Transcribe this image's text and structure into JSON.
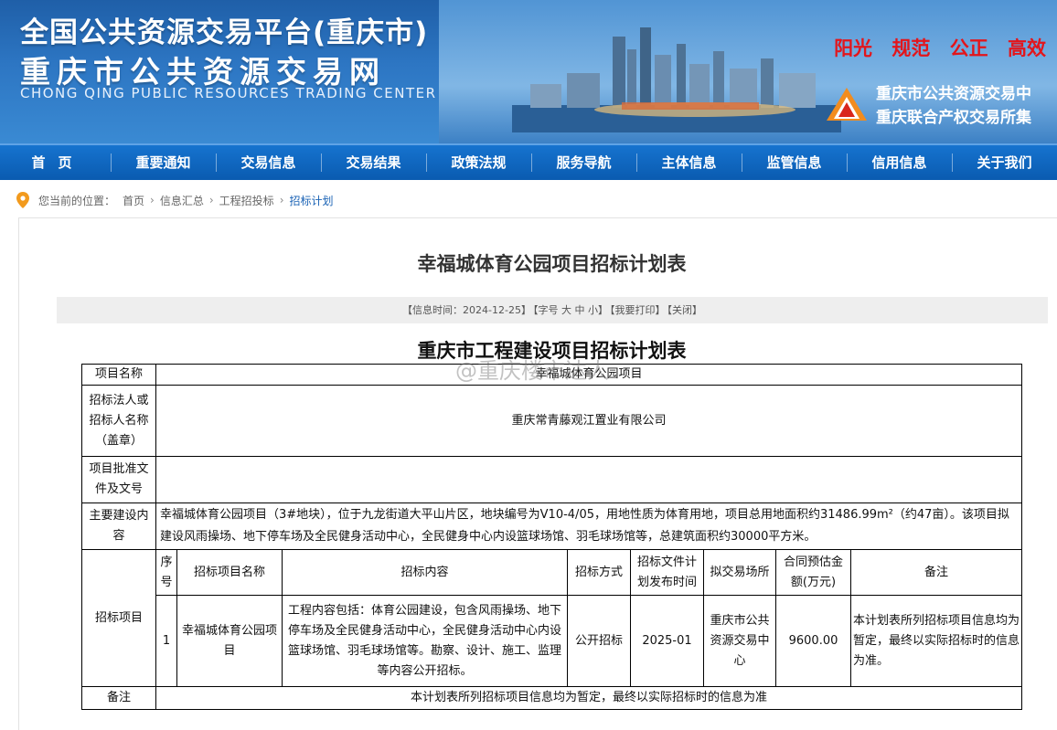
{
  "banner": {
    "title_cn": "全国公共资源交易平台(重庆市)",
    "title_site": "重庆市公共资源交易网",
    "title_en": "CHONG QING PUBLIC RESOURCES TRADING CENTER",
    "slogans": [
      "阳光",
      "规范",
      "公正",
      "高效"
    ],
    "center_names": [
      "重庆市公共资源交易中",
      "重庆联合产权交易所集"
    ]
  },
  "nav": [
    "首页",
    "重要通知",
    "交易信息",
    "交易结果",
    "政策法规",
    "服务导航",
    "主体信息",
    "监管信息",
    "信用信息",
    "关于我们"
  ],
  "breadcrumb": {
    "prefix": "您当前的位置：",
    "items": [
      "首页",
      "信息汇总",
      "工程招投标",
      "招标计划"
    ]
  },
  "article": {
    "title": "幸福城体育公园项目招标计划表",
    "info_time": "【信息时间：2024-12-25】",
    "font_size": "【字号 大 中 小】",
    "print": "【我要打印】",
    "close": "【关闭】"
  },
  "watermark": "@重庆楼市达人",
  "plan_table": {
    "title": "重庆市工程建设项目招标计划表",
    "project_name_label": "项目名称",
    "project_name": "幸福城体育公园项目",
    "tenderer_label": "招标法人或招标人名称（盖章）",
    "tenderer": "重庆常青藤观江置业有限公司",
    "approval_label": "项目批准文件及文号",
    "approval": "",
    "content_label": "主要建设内容",
    "content": "幸福城体育公园项目（3#地块），位于九龙街道大平山片区，地块编号为V10-4/05，用地性质为体育用地，项目总用地面积约31486.99m²（约47亩）。该项目拟建设风雨操场、地下停车场及全民健身活动中心，全民健身中心内设篮球场馆、羽毛球场馆等，总建筑面积约30000平方米。",
    "bid_section_label": "招标项目",
    "headers": [
      "序号",
      "招标项目名称",
      "招标内容",
      "招标方式",
      "招标文件计划发布时间",
      "拟交易场所",
      "合同预估金额(万元)",
      "备注"
    ],
    "rows": [
      {
        "no": "1",
        "name": "幸福城体育公园项目",
        "scope": "工程内容包括：体育公园建设，包含风雨操场、地下停车场及全民健身活动中心，全民健身活动中心内设篮球场馆、羽毛球场馆等。勘察、设计、施工、监理等内容公开招标。",
        "method": "公开招标",
        "release": "2025-01",
        "venue": "重庆市公共资源交易中心",
        "amount": "9600.00",
        "note": "本计划表所列招标项目信息均为暂定，最终以实际招标时的信息为准。"
      }
    ],
    "remark_label": "备注",
    "remark": "本计划表所列招标项目信息均为暂定，最终以实际招标时的信息为准"
  }
}
